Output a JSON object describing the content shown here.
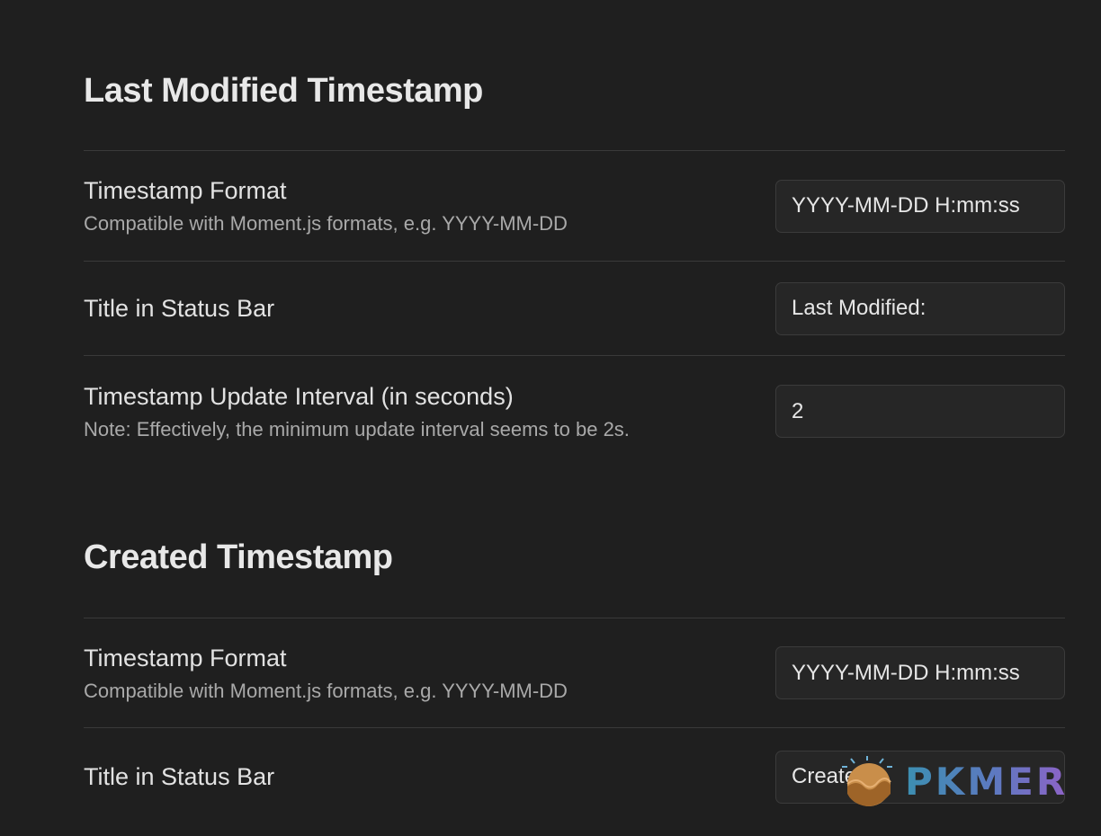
{
  "sections": [
    {
      "heading": "Last Modified Timestamp",
      "settings": [
        {
          "name": "Timestamp Format",
          "description": "Compatible with Moment.js formats, e.g. YYYY-MM-DD",
          "value": "YYYY-MM-DD H:mm:ss"
        },
        {
          "name": "Title in Status Bar",
          "value": "Last Modified:"
        },
        {
          "name": "Timestamp Update Interval (in seconds)",
          "description": "Note: Effectively, the minimum update interval seems to be 2s.",
          "value": "2"
        }
      ]
    },
    {
      "heading": "Created Timestamp",
      "settings": [
        {
          "name": "Timestamp Format",
          "description": "Compatible with Moment.js formats, e.g. YYYY-MM-DD",
          "value": "YYYY-MM-DD H:mm:ss"
        },
        {
          "name": "Title in Status Bar",
          "value": "Created:"
        }
      ]
    }
  ],
  "watermark": {
    "text": "PKMER",
    "colors": [
      "#3c8fb1",
      "#5d79c0",
      "#8e63c7"
    ],
    "logo_colors": [
      "#d29a52",
      "#a86a2c",
      "#6fb3d8"
    ]
  },
  "colors": {
    "background": "#1f1f1f",
    "input_background": "#262626",
    "divider": "#3a3a3a"
  }
}
